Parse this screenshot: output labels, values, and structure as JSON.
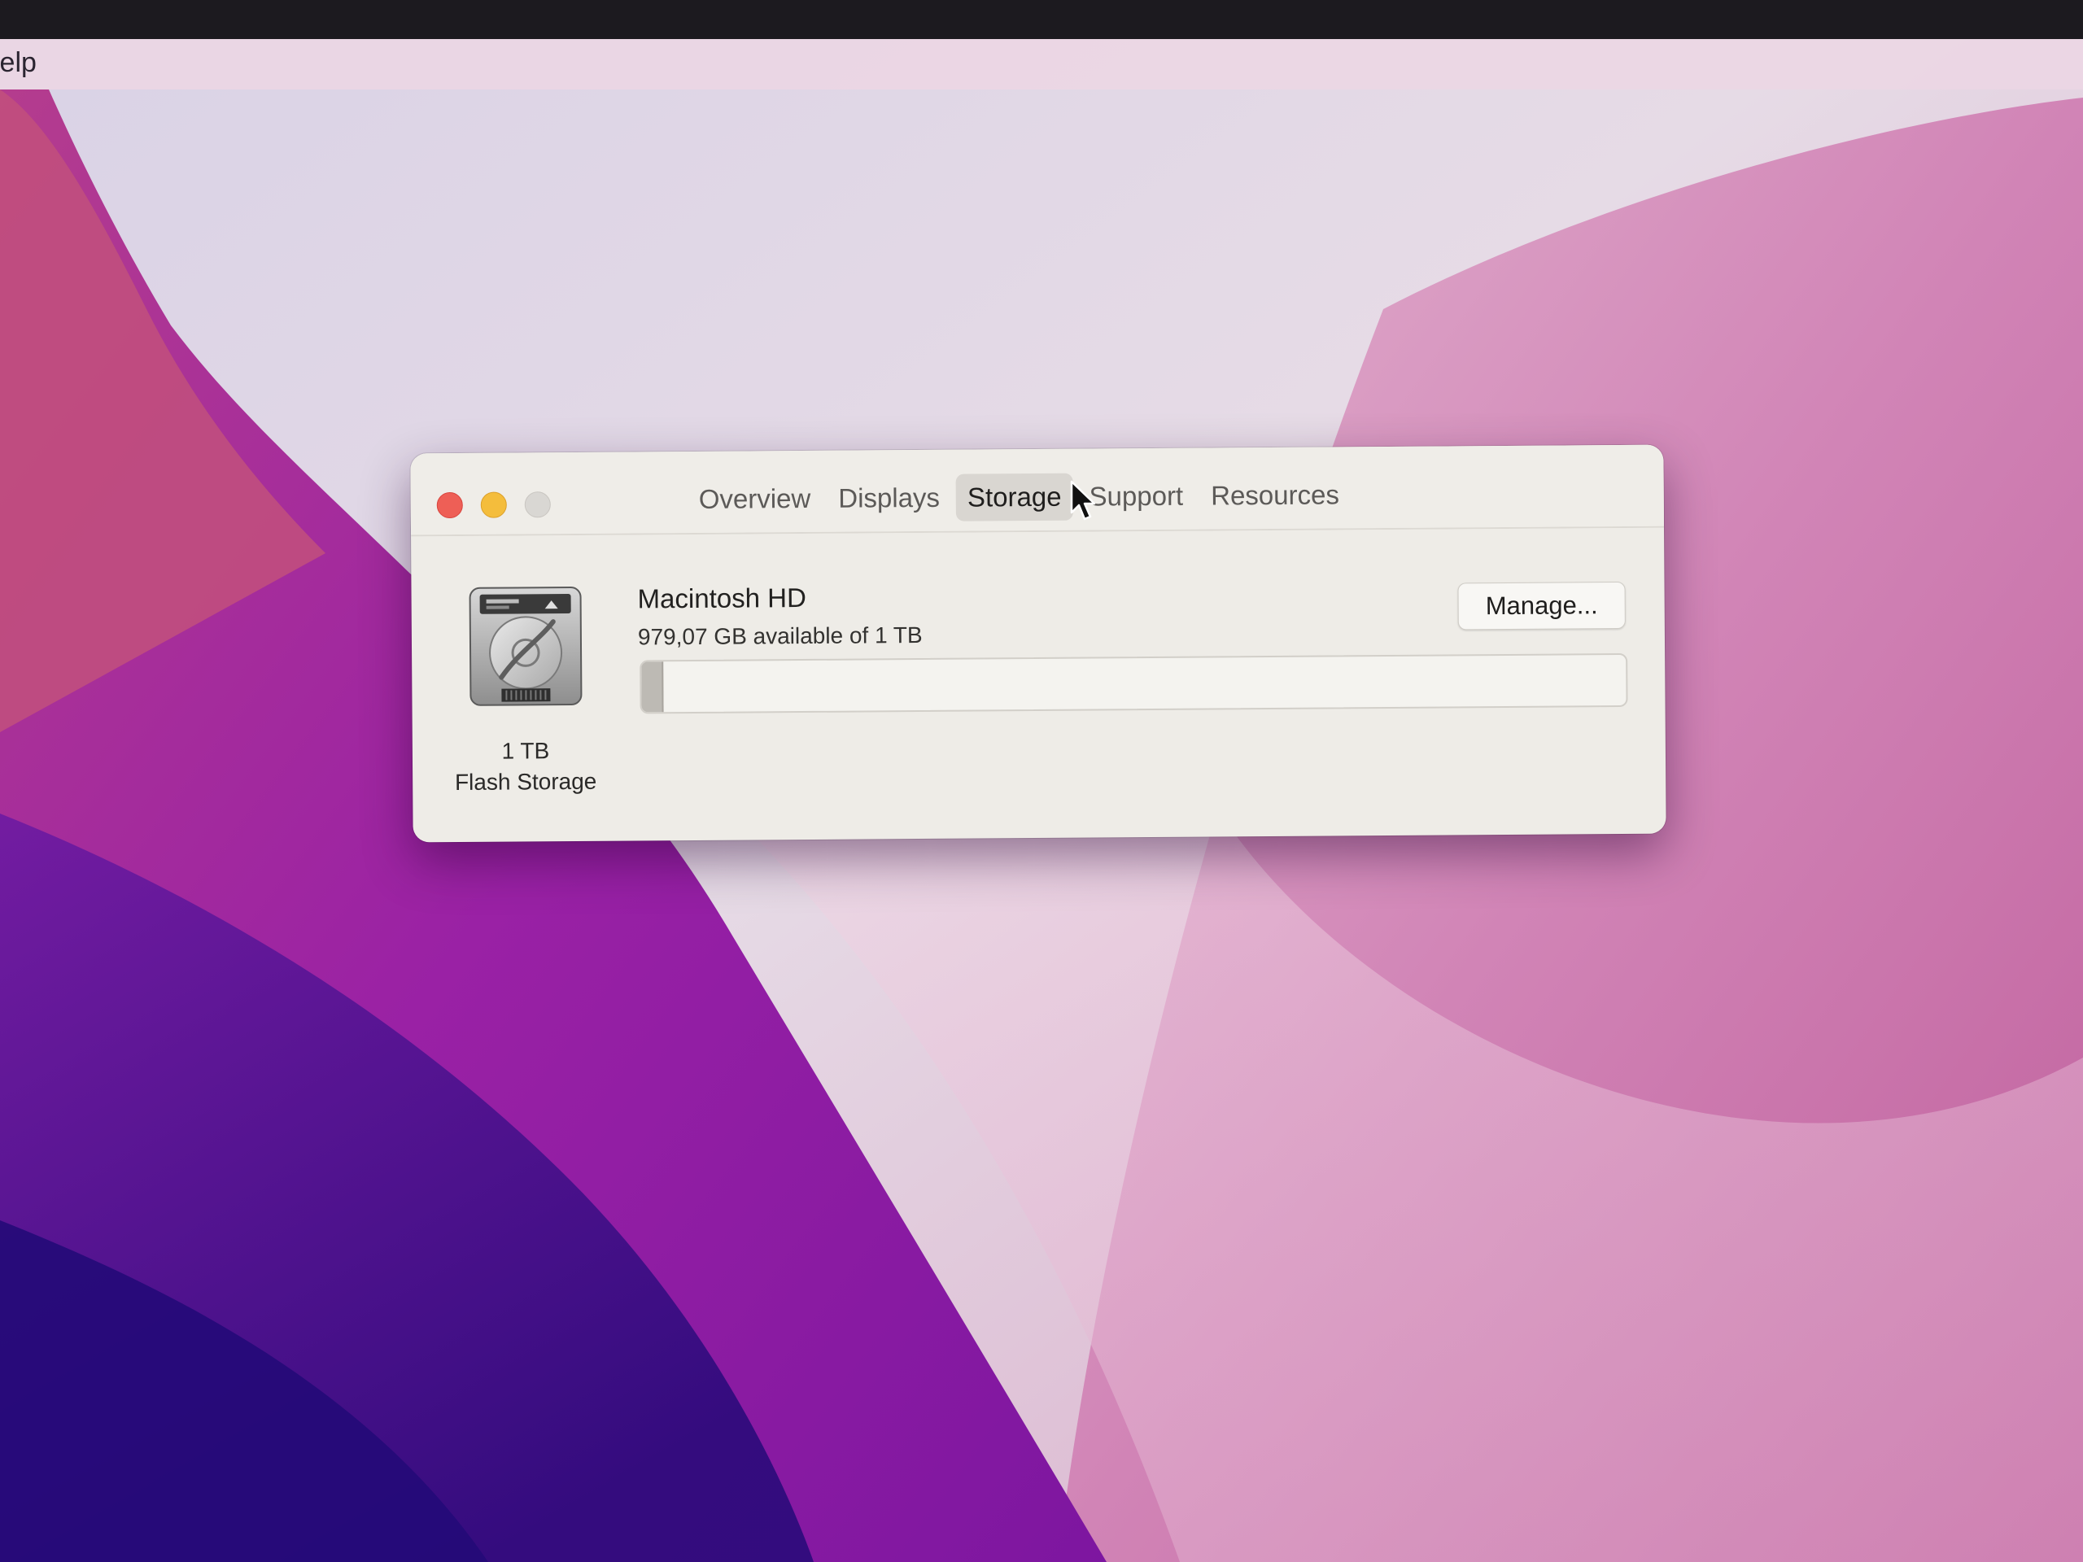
{
  "menubar": {
    "help_label": "lelp"
  },
  "window": {
    "tabs": [
      {
        "label": "Overview"
      },
      {
        "label": "Displays"
      },
      {
        "label": "Storage"
      },
      {
        "label": "Support"
      },
      {
        "label": "Resources"
      }
    ],
    "selected_tab": "Storage",
    "disk": {
      "capacity_label": "1 TB",
      "type_label": "Flash Storage",
      "icon": "hard-drive-icon"
    },
    "volume": {
      "name": "Macintosh HD",
      "availability": "979,07 GB available of 1 TB",
      "used_fraction": 0.021
    },
    "manage_label": "Manage..."
  },
  "colors": {
    "close": "#ee5f56",
    "minimize": "#f4bd3c",
    "zoom_disabled": "#d9d7d3",
    "wallpaper_magenta": "#a12aa8",
    "wallpaper_pink": "#d27bb0"
  }
}
